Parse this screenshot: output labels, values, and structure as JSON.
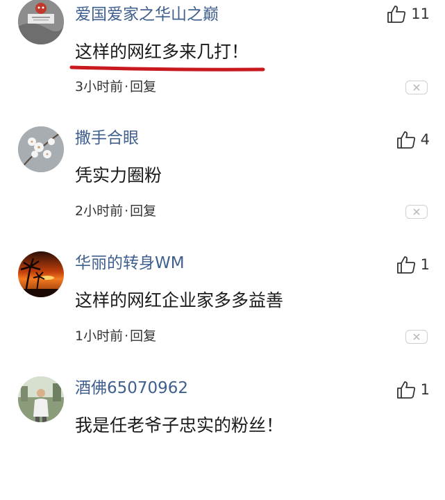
{
  "comments": [
    {
      "username": "爱国爱家之华山之巅",
      "text": "这样的网红多来几打！",
      "time": "3小时前",
      "reply_label": "回复",
      "likes": "11",
      "avatar_icon": "red-panda-avatar-icon",
      "highlight_color": "#c8191e"
    },
    {
      "username": "撒手合眼",
      "text": "凭实力圈粉",
      "time": "2小时前",
      "reply_label": "回复",
      "likes": "4",
      "avatar_icon": "flower-blossom-avatar-icon"
    },
    {
      "username": "华丽的转身WM",
      "text": "这样的网红企业家多多益善",
      "time": "1小时前",
      "reply_label": "回复",
      "likes": "1",
      "avatar_icon": "sunset-palm-avatar-icon"
    },
    {
      "username": "酒佛65070962",
      "text": "我是任老爷子忠实的粉丝！",
      "likes": "1",
      "avatar_icon": "person-photo-avatar-icon"
    }
  ],
  "colors": {
    "username": "#3f5f8f",
    "text": "#1a1a1a",
    "meta": "#333333",
    "dismiss_border": "#cfcfcf"
  },
  "separator": "·"
}
